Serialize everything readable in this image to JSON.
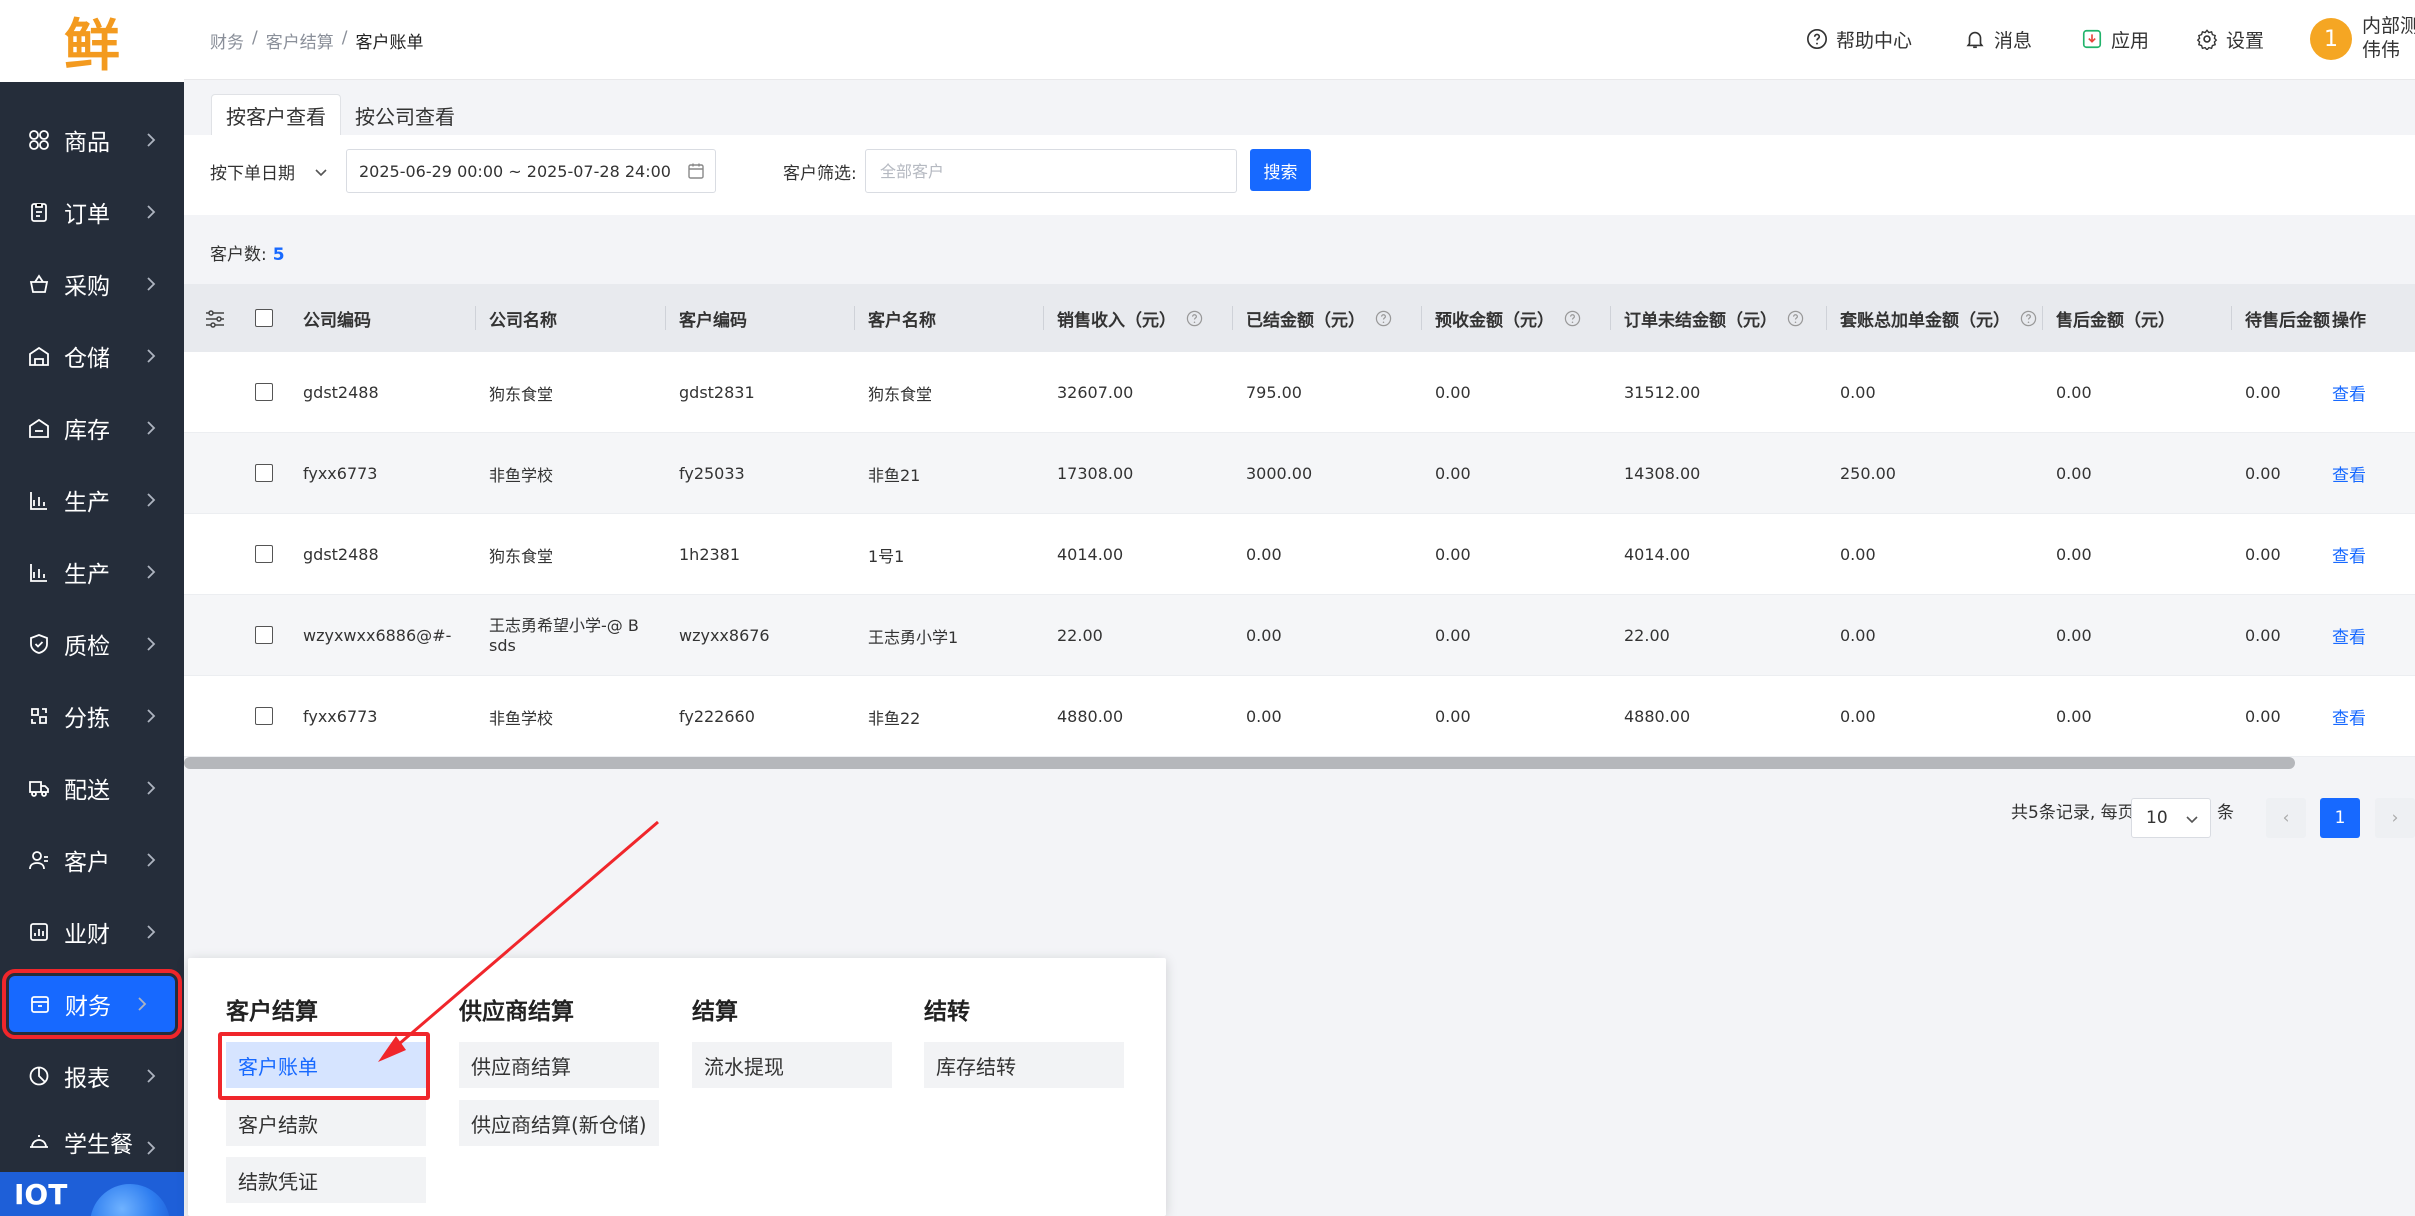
{
  "logo": {
    "text": "鲜"
  },
  "sidebar": {
    "items": [
      {
        "label": "商品",
        "icon": "grid-icon"
      },
      {
        "label": "订单",
        "icon": "clipboard-icon"
      },
      {
        "label": "采购",
        "icon": "basket-icon"
      },
      {
        "label": "仓储",
        "icon": "warehouse-icon"
      },
      {
        "label": "库存",
        "icon": "inventory-icon"
      },
      {
        "label": "生产",
        "icon": "factory-icon"
      },
      {
        "label": "生产",
        "icon": "factory-icon"
      },
      {
        "label": "质检",
        "icon": "shield-icon"
      },
      {
        "label": "分拣",
        "icon": "sort-icon"
      },
      {
        "label": "配送",
        "icon": "truck-icon"
      },
      {
        "label": "客户",
        "icon": "user-icon"
      },
      {
        "label": "业财",
        "icon": "bar-chart-icon"
      },
      {
        "label": "财务",
        "icon": "wallet-icon"
      },
      {
        "label": "报表",
        "icon": "pie-chart-icon"
      },
      {
        "label": "学生餐",
        "icon": "dish-icon"
      }
    ],
    "iot": "IOT"
  },
  "topbar": {
    "breadcrumb": [
      "财务",
      "客户结算",
      "客户账单"
    ],
    "help": "帮助中心",
    "messages": "消息",
    "apps": "应用",
    "settings": "设置",
    "avatar_text": "1",
    "user_line1": "内部测",
    "user_line2": "伟伟"
  },
  "tabs": [
    "按客户查看",
    "按公司查看"
  ],
  "filter": {
    "date_type": "按下单日期",
    "date_range": "2025-06-29 00:00 ~ 2025-07-28 24:00",
    "customer_label": "客户筛选:",
    "customer_placeholder": "全部客户",
    "search_label": "搜索"
  },
  "summary": {
    "label": "客户数:",
    "value": "5"
  },
  "table": {
    "headers": [
      "公司编码",
      "公司名称",
      "客户编码",
      "客户名称",
      "销售收入（元）",
      "已结金额（元）",
      "预收金额（元）",
      "订单未结金额（元）",
      "套账总加单金额（元）",
      "售后金额（元）",
      "待售后金额",
      "操作"
    ],
    "rows": [
      [
        "gdst2488",
        "狗东食堂",
        "gdst2831",
        "狗东食堂",
        "32607.00",
        "795.00",
        "0.00",
        "31512.00",
        "0.00",
        "0.00",
        "0.00",
        "查看"
      ],
      [
        "fyxx6773",
        "非鱼学校",
        "fy25033",
        "非鱼21",
        "17308.00",
        "3000.00",
        "0.00",
        "14308.00",
        "250.00",
        "0.00",
        "0.00",
        "查看"
      ],
      [
        "gdst2488",
        "狗东食堂",
        "1h2381",
        "1号1",
        "4014.00",
        "0.00",
        "0.00",
        "4014.00",
        "0.00",
        "0.00",
        "0.00",
        "查看"
      ],
      [
        "wzyxwxx6886@#-",
        "王志勇希望小学-@ B sds",
        "wzyxx8676",
        "王志勇小学1",
        "22.00",
        "0.00",
        "0.00",
        "22.00",
        "0.00",
        "0.00",
        "0.00",
        "查看"
      ],
      [
        "fyxx6773",
        "非鱼学校",
        "fy222660",
        "非鱼22",
        "4880.00",
        "0.00",
        "0.00",
        "4880.00",
        "0.00",
        "0.00",
        "0.00",
        "查看"
      ]
    ]
  },
  "pagination": {
    "total_text": "共5条记录, 每页",
    "page_size": "10",
    "unit": "条",
    "prev": "‹",
    "current": "1",
    "next": "›"
  },
  "flyout": {
    "columns": [
      {
        "title": "客户结算",
        "items": [
          "客户账单",
          "客户结款",
          "结款凭证"
        ]
      },
      {
        "title": "供应商结算",
        "items": [
          "供应商结算",
          "供应商结算(新仓储)"
        ]
      },
      {
        "title": "结算",
        "items": [
          "流水提现"
        ]
      },
      {
        "title": "结转",
        "items": [
          "库存结转"
        ]
      }
    ]
  },
  "colors": {
    "accent": "#1769ff",
    "sidebar": "#252d3a",
    "highlight": "#f0262b"
  }
}
